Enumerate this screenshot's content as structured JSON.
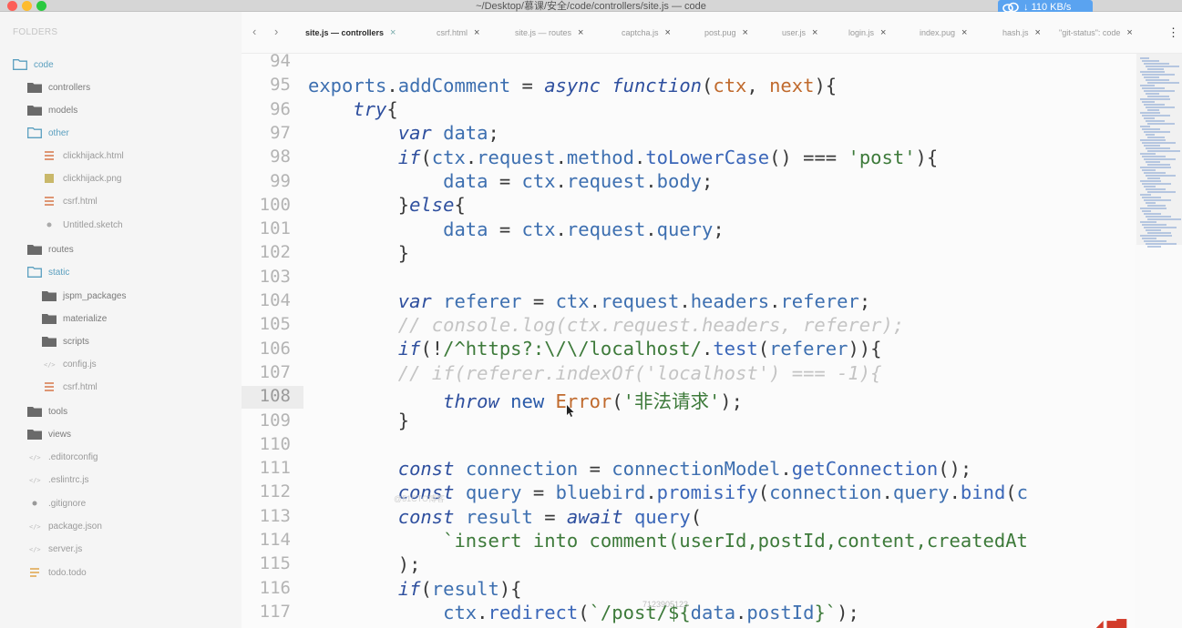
{
  "window": {
    "title": "~/Desktop/慕课/安全/code/controllers/site.js — code",
    "download_speed": "110 KB/s"
  },
  "sidebar": {
    "folders_label": "FOLDERS",
    "items": [
      {
        "label": "code",
        "icon": "folder-open-icon"
      },
      {
        "label": "controllers",
        "icon": "folder-icon"
      },
      {
        "label": "models",
        "icon": "folder-icon"
      },
      {
        "label": "other",
        "icon": "folder-open-icon"
      },
      {
        "label": "clickhijack.html",
        "icon": "html-file-icon"
      },
      {
        "label": "clickhijack.png",
        "icon": "image-file-icon"
      },
      {
        "label": "csrf.html",
        "icon": "html-file-icon"
      },
      {
        "label": "Untitled.sketch",
        "icon": "sketch-file-icon"
      },
      {
        "label": "routes",
        "icon": "folder-icon"
      },
      {
        "label": "static",
        "icon": "folder-open-icon"
      },
      {
        "label": "jspm_packages",
        "icon": "folder-icon"
      },
      {
        "label": "materialize",
        "icon": "folder-icon"
      },
      {
        "label": "scripts",
        "icon": "folder-icon"
      },
      {
        "label": "config.js",
        "icon": "js-file-icon"
      },
      {
        "label": "csrf.html",
        "icon": "html-file-icon"
      },
      {
        "label": "tools",
        "icon": "folder-icon"
      },
      {
        "label": "views",
        "icon": "folder-icon"
      },
      {
        "label": ".editorconfig",
        "icon": "config-file-icon"
      },
      {
        "label": ".eslintrc.js",
        "icon": "config-file-icon"
      },
      {
        "label": ".gitignore",
        "icon": "gitignore-file-icon"
      },
      {
        "label": "package.json",
        "icon": "json-file-icon"
      },
      {
        "label": "server.js",
        "icon": "js-file-icon"
      },
      {
        "label": "todo.todo",
        "icon": "todo-file-icon"
      }
    ]
  },
  "tabs": [
    {
      "label": "site.js — controllers",
      "active": true
    },
    {
      "label": "csrf.html",
      "active": false
    },
    {
      "label": "site.js — routes",
      "active": false
    },
    {
      "label": "captcha.js",
      "active": false
    },
    {
      "label": "post.pug",
      "active": false
    },
    {
      "label": "user.js",
      "active": false
    },
    {
      "label": "login.js",
      "active": false
    },
    {
      "label": "index.pug",
      "active": false
    },
    {
      "label": "hash.js",
      "active": false
    },
    {
      "label": "\"git-status\": code",
      "active": false
    }
  ],
  "editor": {
    "current_line": "108",
    "line_numbers": [
      "94",
      "95",
      "96",
      "97",
      "98",
      "99",
      "100",
      "101",
      "102",
      "103",
      "104",
      "105",
      "106",
      "107",
      "108",
      "109",
      "110",
      "111",
      "112",
      "113",
      "114",
      "115",
      "116",
      "117"
    ],
    "watermarks": [
      "@51CTO博客",
      "7123905123"
    ]
  },
  "colors": {
    "keyword": "#2e4f9e",
    "string": "#3d7a3a",
    "class": "#c06a2d",
    "comment": "#c4c4c4",
    "accent": "#5aa3f0"
  }
}
